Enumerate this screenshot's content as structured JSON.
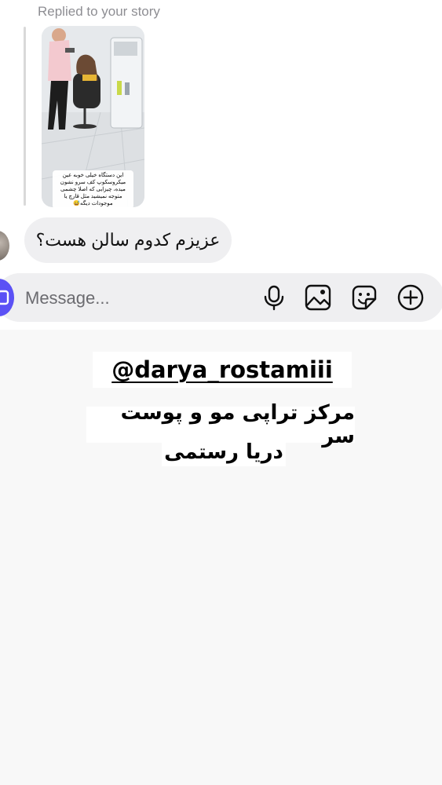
{
  "reply_context": "Replied to your story",
  "story": {
    "caption": "این دستگاه خیلی خوبه عین میکروسکوپ کف سرو نشون میده، چیزایی که اصلا چشمی متوجه نمیشید مثل قارچ یا موجودات دیگه😅"
  },
  "message": {
    "text": "عزیزم کدوم سالن هست؟"
  },
  "composer": {
    "placeholder": "Message...",
    "icons": [
      "camera-icon",
      "microphone-icon",
      "gallery-icon",
      "sticker-icon",
      "add-icon"
    ],
    "accent_color": "#5b51f5"
  },
  "overlay": {
    "username": "@darya_rostamiii",
    "title_line1": "مرکز تراپی مو و پوست سر",
    "title_line2": "دریا رستمی"
  }
}
